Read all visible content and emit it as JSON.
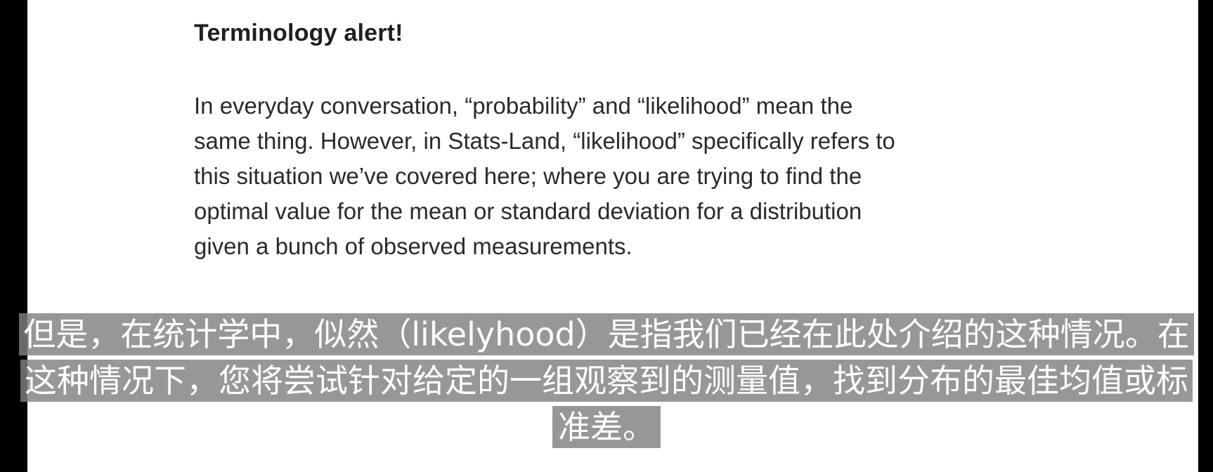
{
  "slide": {
    "title": "Terminology alert!",
    "body_lines": [
      "In everyday conversation, “probability” and “likelihood” mean the",
      "same thing. However, in Stats-Land, “likelihood” specifically refers to",
      "this situation we’ve covered here; where you are trying to find the",
      "optimal value for the mean or standard deviation for a distribution",
      "given a bunch of observed measurements."
    ]
  },
  "subtitles": {
    "lines": [
      "但是，在统计学中，似然（likelyhood）是指我们已经在此处介绍的这种情况。在",
      "这种情况下，您将尝试针对给定的一组观察到的测量值，找到分布的最佳均值或标",
      "准差。"
    ]
  },
  "colors": {
    "slide_background": "#ffffff",
    "letterbox": "#000000",
    "subtitle_background": "#808080",
    "subtitle_text": "#ffffff"
  }
}
